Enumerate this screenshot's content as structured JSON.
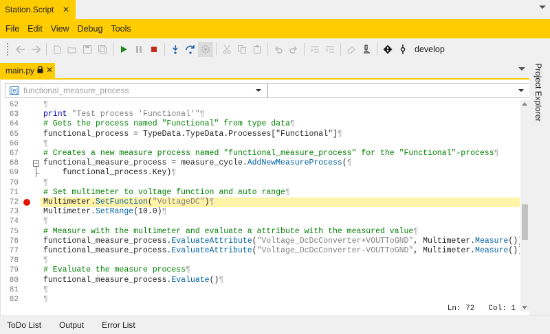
{
  "window": {
    "tab_title": "Station.Script",
    "tab_close": "✕"
  },
  "menu": [
    "File",
    "Edit",
    "View",
    "Debug",
    "Tools"
  ],
  "toolbar": {
    "branch": "develop"
  },
  "editor": {
    "tab_label": "main.py",
    "tab_close": "✕",
    "nav_left": "functional_measure_process",
    "nav_right": "",
    "status_ln": "Ln: 72",
    "status_col": "Col: 1",
    "lines": [
      {
        "n": "62",
        "segments": [
          {
            "c": "pil",
            "t": "¶"
          }
        ]
      },
      {
        "n": "63",
        "segments": [
          {
            "c": "kw",
            "t": "print"
          },
          {
            "c": "",
            "t": " "
          },
          {
            "c": "str",
            "t": "\"Test process 'Functional'\""
          },
          {
            "c": "pil",
            "t": "¶"
          }
        ]
      },
      {
        "n": "64",
        "segments": [
          {
            "c": "cm",
            "t": "# Gets the process named \"Functional\" from type data"
          },
          {
            "c": "pil",
            "t": "¶"
          }
        ]
      },
      {
        "n": "65",
        "segments": [
          {
            "c": "",
            "t": "functional_process = TypeData.TypeData.Processes[\"Functional\"]"
          },
          {
            "c": "pil",
            "t": "¶"
          }
        ]
      },
      {
        "n": "66",
        "segments": [
          {
            "c": "pil",
            "t": "¶"
          }
        ]
      },
      {
        "n": "67",
        "segments": [
          {
            "c": "cm",
            "t": "# Creates a new measure process named \"functional_measure_process\" for the \"Functional\"-process"
          },
          {
            "c": "pil",
            "t": "¶"
          }
        ]
      },
      {
        "n": "68",
        "segments": [
          {
            "c": "",
            "t": "functional_measure_process = measure_cycle."
          },
          {
            "c": "fn",
            "t": "AddNewMeasureProcess"
          },
          {
            "c": "",
            "t": "("
          },
          {
            "c": "pil",
            "t": "¶"
          }
        ]
      },
      {
        "n": "69",
        "segments": [
          {
            "c": "",
            "t": "    functional_process.Key)"
          },
          {
            "c": "pil",
            "t": "¶"
          }
        ]
      },
      {
        "n": "70",
        "segments": [
          {
            "c": "pil",
            "t": "¶"
          }
        ]
      },
      {
        "n": "71",
        "segments": [
          {
            "c": "cm",
            "t": "# Set multimeter to voltage function and auto range"
          },
          {
            "c": "pil",
            "t": "¶"
          }
        ]
      },
      {
        "n": "72",
        "segments": [
          {
            "c": "",
            "t": "Multimeter."
          },
          {
            "c": "fn",
            "t": "SetFunction"
          },
          {
            "c": "",
            "t": "("
          },
          {
            "c": "str",
            "t": "\"VoltageDC\""
          },
          {
            "c": "",
            "t": ")"
          },
          {
            "c": "pil",
            "t": "¶"
          }
        ]
      },
      {
        "n": "73",
        "segments": [
          {
            "c": "",
            "t": "Multimeter."
          },
          {
            "c": "fn",
            "t": "SetRange"
          },
          {
            "c": "",
            "t": "(10.0)"
          },
          {
            "c": "pil",
            "t": "¶"
          }
        ]
      },
      {
        "n": "74",
        "segments": [
          {
            "c": "pil",
            "t": "¶"
          }
        ]
      },
      {
        "n": "75",
        "segments": [
          {
            "c": "cm",
            "t": "# Measure with the multimeter and evaluate a attribute with the measured value"
          },
          {
            "c": "pil",
            "t": "¶"
          }
        ]
      },
      {
        "n": "76",
        "segments": [
          {
            "c": "",
            "t": "functional_measure_process."
          },
          {
            "c": "fn",
            "t": "EvaluateAttribute"
          },
          {
            "c": "",
            "t": "("
          },
          {
            "c": "str",
            "t": "\"Voltage_DcDcConverter+VOUTToGND\""
          },
          {
            "c": "",
            "t": ", Multimeter."
          },
          {
            "c": "fn",
            "t": "Measure"
          },
          {
            "c": "",
            "t": "())"
          },
          {
            "c": "pil",
            "t": "¶"
          }
        ]
      },
      {
        "n": "77",
        "segments": [
          {
            "c": "",
            "t": "functional_measure_process."
          },
          {
            "c": "fn",
            "t": "EvaluateAttribute"
          },
          {
            "c": "",
            "t": "("
          },
          {
            "c": "str",
            "t": "\"Voltage_DcDcConverter-VOUTToGND\""
          },
          {
            "c": "",
            "t": ", Multimeter."
          },
          {
            "c": "fn",
            "t": "Measure"
          },
          {
            "c": "",
            "t": "())"
          },
          {
            "c": "pil",
            "t": "¶"
          }
        ]
      },
      {
        "n": "78",
        "segments": [
          {
            "c": "pil",
            "t": "¶"
          }
        ]
      },
      {
        "n": "79",
        "segments": [
          {
            "c": "cm",
            "t": "# Evaluate the measure process"
          },
          {
            "c": "pil",
            "t": "¶"
          }
        ]
      },
      {
        "n": "80",
        "segments": [
          {
            "c": "",
            "t": "functional_measure_process."
          },
          {
            "c": "fn",
            "t": "Evaluate"
          },
          {
            "c": "",
            "t": "()"
          },
          {
            "c": "pil",
            "t": "¶"
          }
        ]
      },
      {
        "n": "81",
        "segments": [
          {
            "c": "pil",
            "t": "¶"
          }
        ]
      },
      {
        "n": "82",
        "segments": [
          {
            "c": "pil",
            "t": "¶"
          }
        ]
      },
      {
        "n": "",
        "segments": [
          {
            "c": "pil",
            "t": "¶"
          }
        ]
      }
    ],
    "current_line": "72",
    "breakpoint_line": "72"
  },
  "side_panel": {
    "label": "Project Explorer"
  },
  "bottom_tabs": [
    "ToDo List",
    "Output",
    "Error List"
  ],
  "colors": {
    "accent": "#ffcc00",
    "breakpoint": "#e51400",
    "current_line": "#fff3a8",
    "comment": "#008000",
    "keyword": "#0000c8",
    "string": "#808080"
  }
}
